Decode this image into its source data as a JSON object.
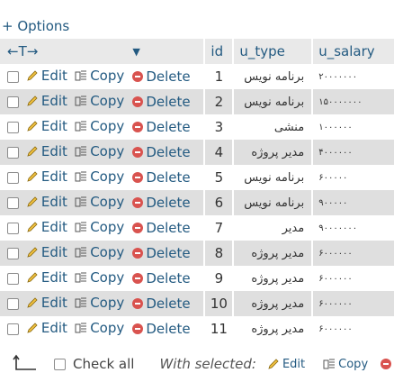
{
  "options_label": "+ Options",
  "header": {
    "arrows": "←T→",
    "sort_icon": "▼",
    "col_id": "id",
    "col_type": "u_type",
    "col_salary": "u_salary"
  },
  "actions": {
    "edit": "Edit",
    "copy": "Copy",
    "delete": "Delete"
  },
  "rows": [
    {
      "id": "1",
      "u_type": "برنامه نویس",
      "u_salary": "۲۰۰۰۰۰۰۰"
    },
    {
      "id": "2",
      "u_type": "برنامه نویس",
      "u_salary": "۱۵۰۰۰۰۰۰۰"
    },
    {
      "id": "3",
      "u_type": "منشی",
      "u_salary": "۱۰۰۰۰۰۰"
    },
    {
      "id": "4",
      "u_type": "مدیر پروژه",
      "u_salary": "۴۰۰۰۰۰۰"
    },
    {
      "id": "5",
      "u_type": "برنامه نویس",
      "u_salary": "۶۰۰۰۰۰"
    },
    {
      "id": "6",
      "u_type": "برنامه نویس",
      "u_salary": "۹۰۰۰۰۰"
    },
    {
      "id": "7",
      "u_type": "مدیر",
      "u_salary": "۹۰۰۰۰۰۰۰"
    },
    {
      "id": "8",
      "u_type": "مدیر پروژه",
      "u_salary": "۶۰۰۰۰۰۰"
    },
    {
      "id": "9",
      "u_type": "مدیر پروژه",
      "u_salary": "۶۰۰۰۰۰۰"
    },
    {
      "id": "10",
      "u_type": "مدیر پروژه",
      "u_salary": "۶۰۰۰۰۰۰"
    },
    {
      "id": "11",
      "u_type": "مدیر پروژه",
      "u_salary": "۶۰۰۰۰۰۰"
    }
  ],
  "footer": {
    "check_all": "Check all",
    "with_selected": "With selected:",
    "edit": "Edit",
    "copy": "Copy"
  },
  "colors": {
    "link": "#235a81",
    "delete": "#d9534f",
    "row_alt": "#dfdfdf",
    "header_bg": "#e9e9e9"
  }
}
